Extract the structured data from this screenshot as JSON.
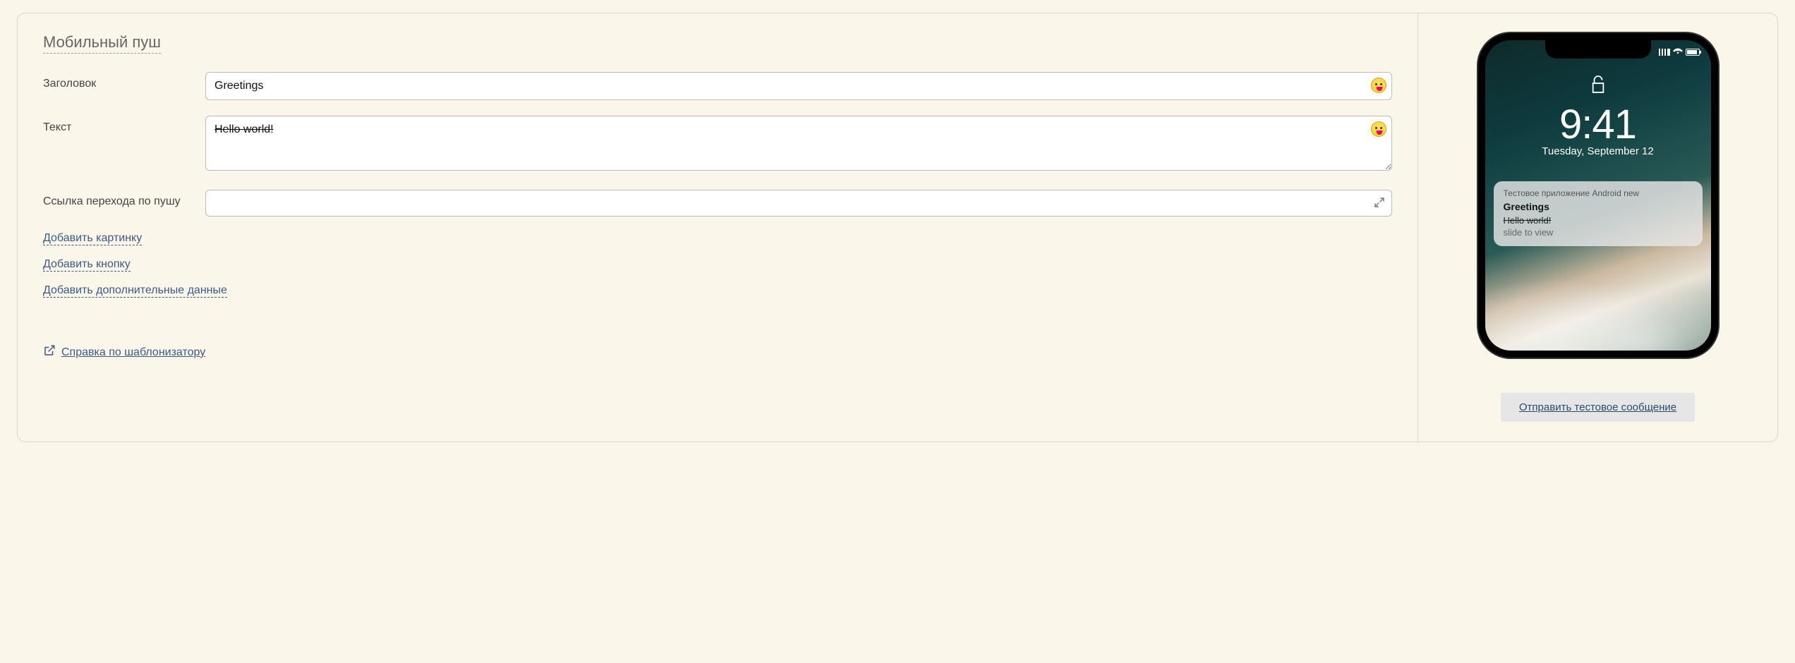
{
  "section_title": "Мобильный пуш",
  "labels": {
    "title": "Заголовок",
    "text": "Текст",
    "link": "Ссылка перехода по пушу"
  },
  "fields": {
    "title_value": "Greetings",
    "text_value": "Hello world!",
    "link_value": ""
  },
  "add_links": {
    "image": "Добавить картинку",
    "button": "Добавить кнопку",
    "data": "Добавить дополнительные данные"
  },
  "help_link": "Справка по шаблонизатору",
  "preview": {
    "time": "9:41",
    "date": "Tuesday, September 12",
    "app_name": "Тестовое приложение Android new",
    "notif_title": "Greetings",
    "notif_body": "Hello world!",
    "slide": "slide to view"
  },
  "test_button": "Отправить тестовое сообщение"
}
